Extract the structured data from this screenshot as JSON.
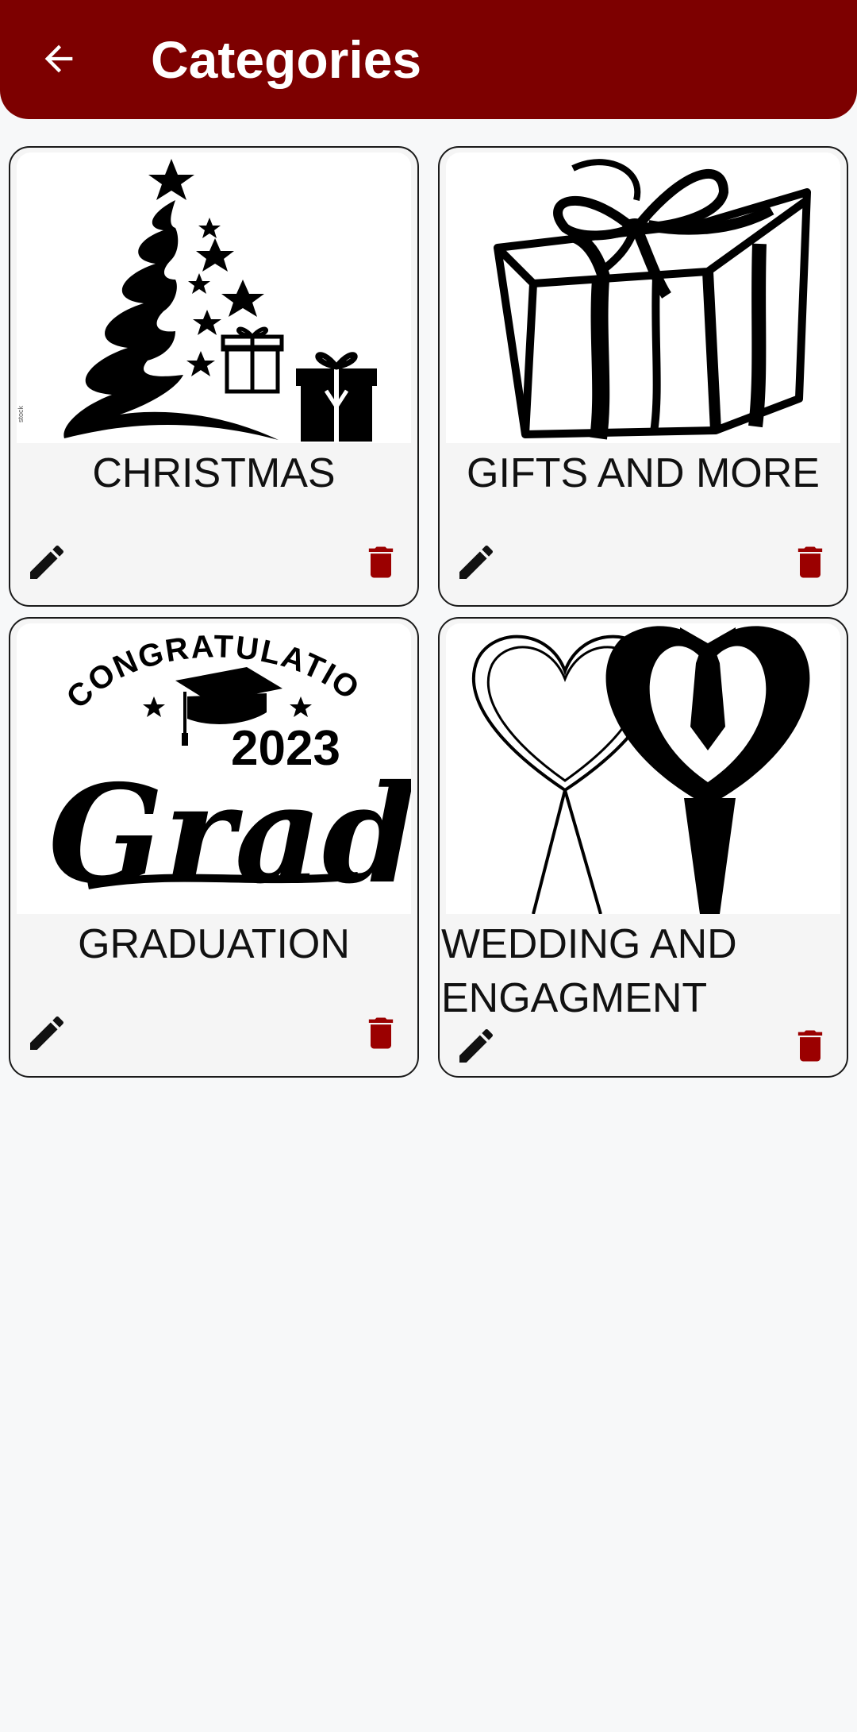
{
  "app_bar": {
    "title": "Categories",
    "back_icon": "arrow-left-icon"
  },
  "colors": {
    "primary": "#7d0000",
    "delete_icon": "#9b0000",
    "edit_icon": "#111111",
    "background": "#f7f8f9"
  },
  "categories": [
    {
      "label": "CHRISTMAS",
      "image": "christmas-tree-illustration"
    },
    {
      "label": "GIFTS AND MORE",
      "image": "gift-box-illustration"
    },
    {
      "label": "GRADUATION",
      "image": "graduation-2023-illustration",
      "image_text": {
        "arc": "CONGRATULATIONS",
        "year": "2023",
        "word": "Grad"
      }
    },
    {
      "label": "WEDDING AND ENGAGMENT",
      "image": "heart-couple-illustration"
    }
  ],
  "actions": {
    "edit_icon": "pencil-icon",
    "delete_icon": "trash-icon"
  }
}
